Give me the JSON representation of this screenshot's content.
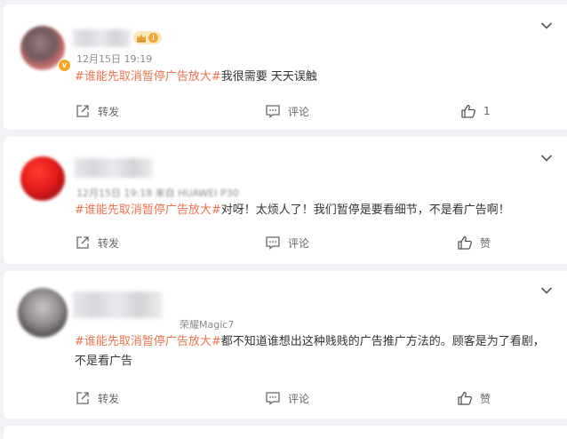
{
  "comments": [
    {
      "time": "12月15日 19:19",
      "topic": "#谁能先取消暂停广告放大#",
      "text": "我很需要 天天误触",
      "actions": {
        "share": "转发",
        "comment": "评论",
        "like": "1"
      },
      "level": "I"
    },
    {
      "time_device": "12月15日 19:18 来自 HUAWEI P30",
      "topic": "#谁能先取消暂停广告放大#",
      "text": "对呀！太烦人了！我们暂停是要看细节，不是看广告啊！",
      "actions": {
        "share": "转发",
        "comment": "评论",
        "like": "赞"
      }
    },
    {
      "device": "荣耀Magic7",
      "topic": "#谁能先取消暂停广告放大#",
      "text": "都不知道谁想出这种贱贱的广告推广方法的。顾客是为了看剧，不是看广告",
      "actions": {
        "share": "转发",
        "comment": "评论",
        "like": "赞"
      }
    }
  ],
  "colors": {
    "topic": "#eb7350",
    "text": "#333333",
    "meta": "#8b8b8b",
    "background": "#f1f2f5"
  },
  "icons": {
    "share": "share-icon",
    "comment": "comment-icon",
    "like": "thumbs-up-icon",
    "menu": "chevron-down-icon",
    "verified": "verified-badge-icon",
    "crown": "crown-icon"
  }
}
